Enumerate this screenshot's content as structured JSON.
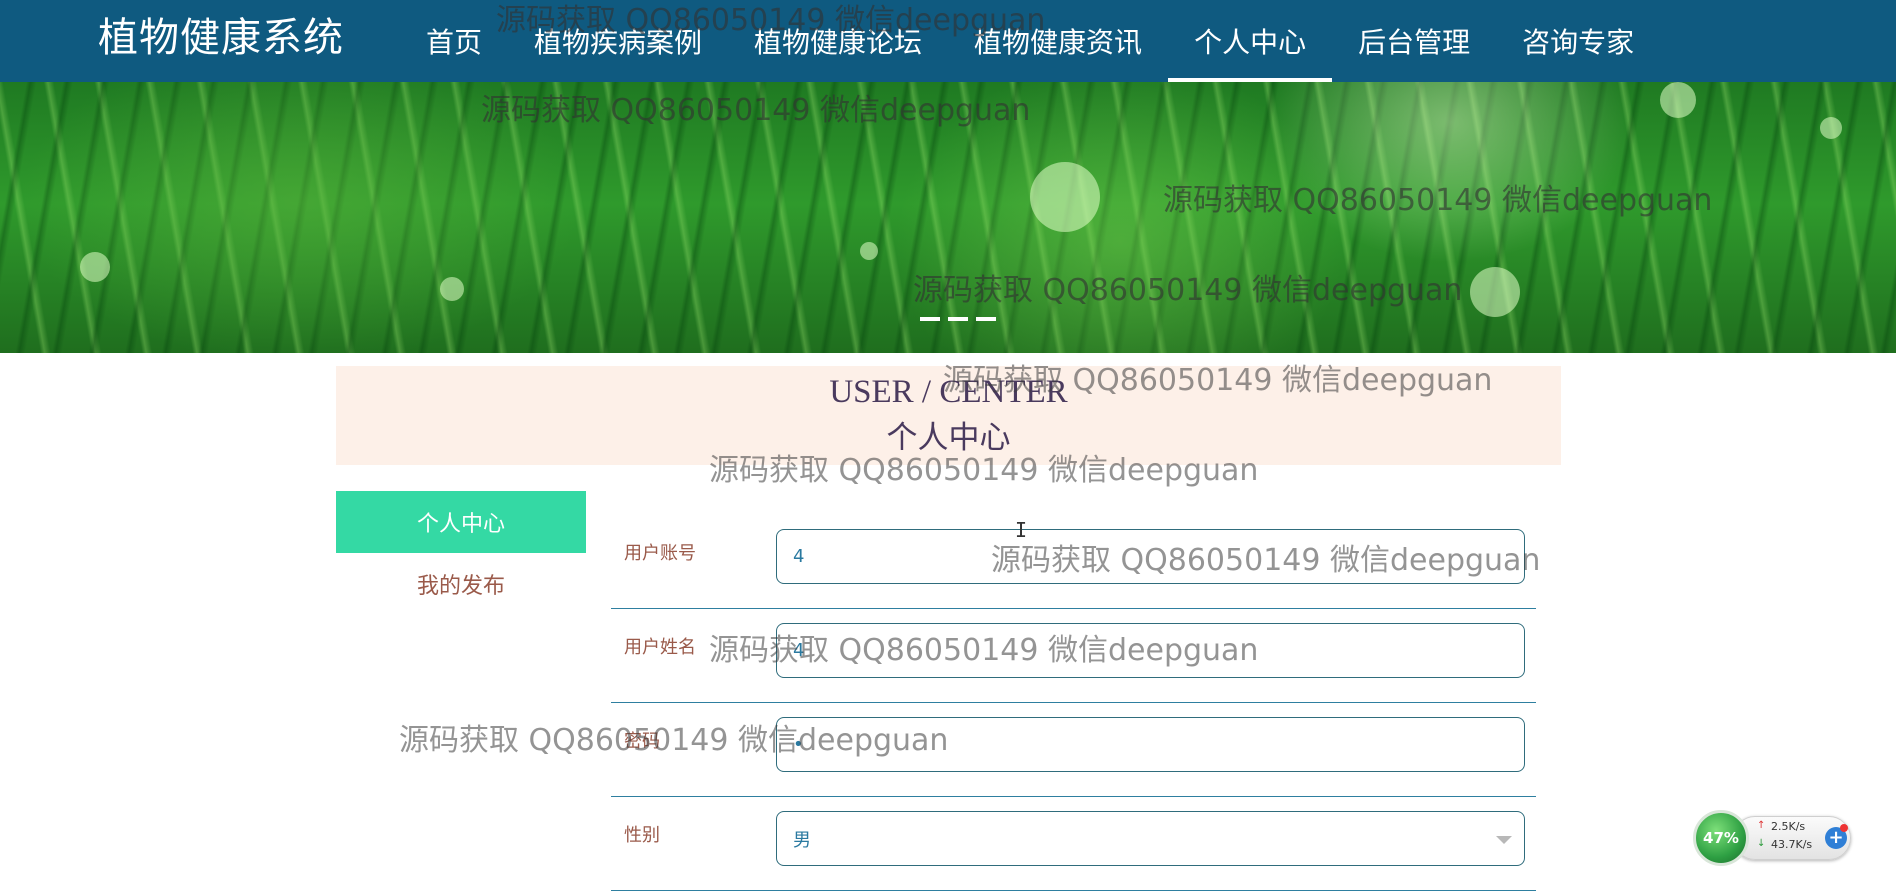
{
  "brand": "植物健康系统",
  "nav": {
    "items": [
      "首页",
      "植物疾病案例",
      "植物健康论坛",
      "植物健康资讯",
      "个人中心",
      "后台管理",
      "咨询专家"
    ],
    "active": "个人中心"
  },
  "heading": {
    "en": "USER / CENTER",
    "cn": "个人中心"
  },
  "side_menu": {
    "items": [
      "个人中心",
      "我的发布"
    ],
    "active": "个人中心"
  },
  "form": {
    "fields": [
      {
        "label": "用户账号",
        "value": "4"
      },
      {
        "label": "用户姓名",
        "value": "4"
      },
      {
        "label": "密码",
        "value": "•"
      },
      {
        "label": "性别",
        "value": "男"
      }
    ]
  },
  "watermark_text": "源码获取 QQ86050149 微信deepguan",
  "net_widget": {
    "percent": "47%",
    "upload": "2.5K/s",
    "download": "43.7K/s"
  },
  "colors": {
    "nav_bg": "#0f5a80",
    "side_active": "#34d9a4",
    "heading_bg": "#fdf0e8"
  }
}
